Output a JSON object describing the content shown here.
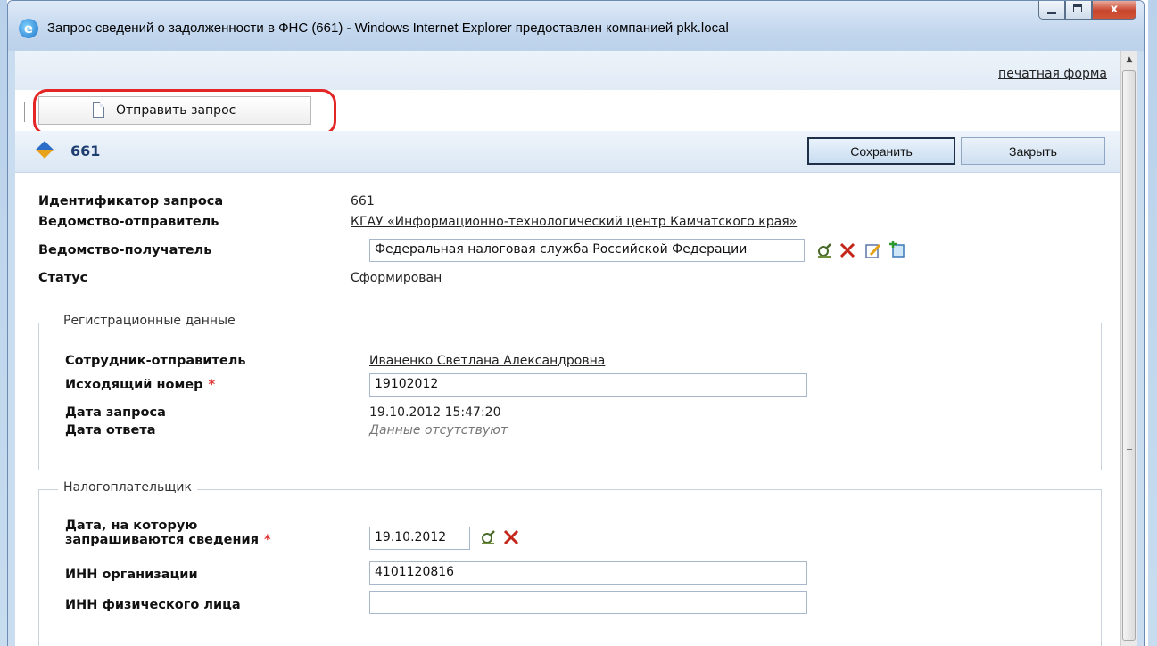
{
  "window": {
    "title": "Запрос сведений о задолженности в ФНС (661) - Windows Internet Explorer предоставлен компанией pkk.local",
    "close_glyph": "x",
    "logo_glyph": "e"
  },
  "header": {
    "print_link": "печатная форма"
  },
  "toolbar": {
    "send_label": "Отправить запрос"
  },
  "record": {
    "id": "661",
    "save_label": "Сохранить",
    "close_label": "Закрыть"
  },
  "main": {
    "request_id_label": "Идентификатор запроса",
    "request_id_value": "661",
    "sender_dept_label": "Ведомство-отправитель",
    "sender_dept_value": "КГАУ «Информационно-технологический центр Камчатского края»",
    "recipient_dept_label": "Ведомство-получатель",
    "recipient_dept_value": "Федеральная налоговая служба Российской Федерации",
    "status_label": "Статус",
    "status_value": "Сформирован"
  },
  "registration": {
    "legend": "Регистрационные данные",
    "employee_label": "Сотрудник-отправитель",
    "employee_value": "Иваненко Светлана Александровна",
    "outgoing_label": "Исходящий номер",
    "outgoing_value": "19102012",
    "request_date_label": "Дата запроса",
    "request_date_value": "19.10.2012 15:47:20",
    "response_date_label": "Дата ответа",
    "response_date_value": "Данные отсутствуют",
    "required_mark": "*"
  },
  "taxpayer": {
    "legend": "Налогоплательщик",
    "date_label_line1": "Дата, на которую",
    "date_label_line2": "запрашиваются сведения",
    "date_value": "19.10.2012",
    "org_inn_label": "ИНН организации",
    "org_inn_value": "4101120816",
    "person_inn_label": "ИНН физического лица",
    "person_inn_value": "",
    "required_mark": "*"
  }
}
